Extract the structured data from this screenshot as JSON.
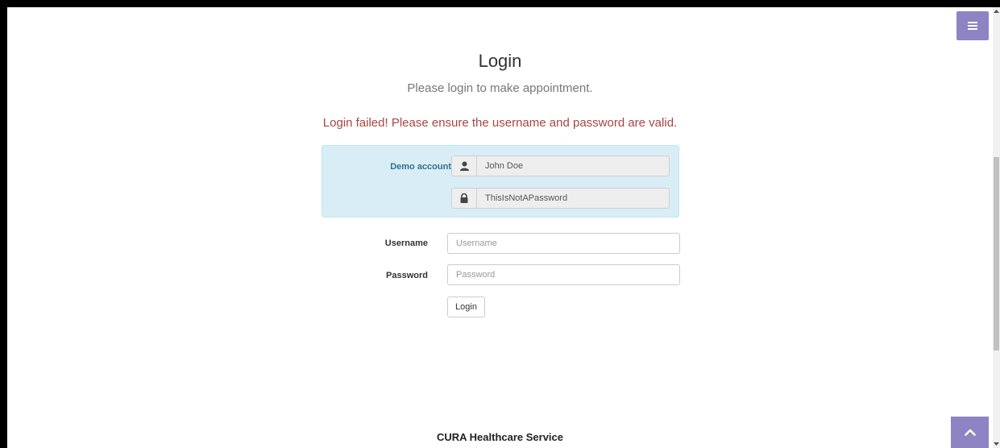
{
  "page": {
    "title": "Login",
    "subtitle": "Please login to make appointment.",
    "error": "Login failed! Please ensure the username and password are valid."
  },
  "demo": {
    "label": "Demo account",
    "username_value": "John Doe",
    "password_value": "ThisIsNotAPassword",
    "username_icon": "user-icon",
    "password_icon": "lock-icon"
  },
  "form": {
    "username_label": "Username",
    "username_placeholder": "Username",
    "username_value": "",
    "password_label": "Password",
    "password_placeholder": "Password",
    "password_value": "",
    "login_button": "Login"
  },
  "footer": {
    "title": "CURA Healthcare Service"
  },
  "colors": {
    "accent": "#8e83c3",
    "demo_bg": "#d9edf7",
    "error": "#a94442"
  }
}
